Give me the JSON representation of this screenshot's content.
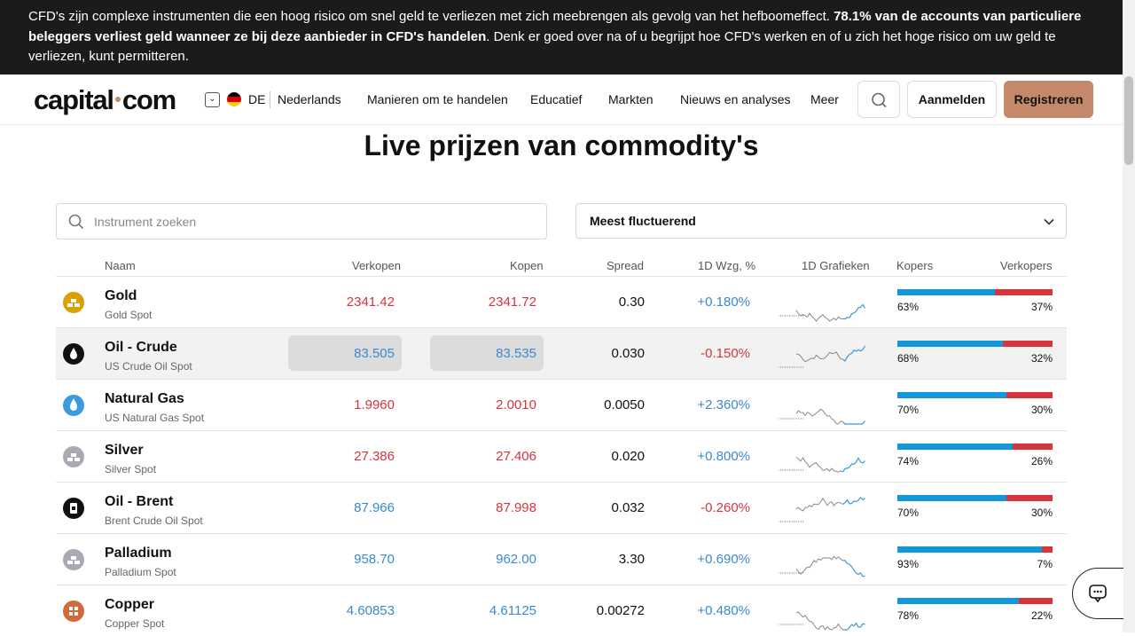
{
  "risk_banner": {
    "part1": "CFD's zijn complexe instrumenten die een hoog risico om snel geld te verliezen met zich meebrengen als gevolg van het hefboomeffect. ",
    "bold": "78.1% van de accounts van particuliere beleggers verliest geld wanneer ze bij deze aanbieder in CFD's handelen",
    "part2": ". Denk er goed over na of u begrijpt hoe CFD's werken en of u zich het hoge risico om uw geld te verliezen, kunt permitteren."
  },
  "header": {
    "logo": "capital·com",
    "logo_left": "capital",
    "logo_right": "com",
    "lang_code": "DE",
    "lang_name": "Nederlands",
    "nav": [
      "Manieren om te handelen",
      "Educatief",
      "Markten",
      "Nieuws en analyses",
      "Meer"
    ],
    "login": "Aanmelden",
    "register": "Registreren"
  },
  "page_title": "Live prijzen van commodity's",
  "search": {
    "placeholder": "Instrument zoeken"
  },
  "sort": {
    "selected": "Meest fluctuerend"
  },
  "columns": {
    "name": "Naam",
    "sell": "Verkopen",
    "buy": "Kopen",
    "spread": "Spread",
    "change": "1D Wzg, %",
    "charts": "1D Grafieken",
    "buyers": "Kopers",
    "sellers": "Verkopers"
  },
  "rows": [
    {
      "name": "Gold",
      "sub": "Gold Spot",
      "sell": "2341.42",
      "buy": "2341.72",
      "spread": "0.30",
      "change": "+0.180%",
      "buyers": "63%",
      "sellers": "37%",
      "buyers_frac": 0.63,
      "price_color": "red",
      "change_color": "blue",
      "icon": "gold-bars-icon",
      "icon_color": "#d8a100",
      "highlight": false
    },
    {
      "name": "Oil - Crude",
      "sub": "US Crude Oil Spot",
      "sell": "83.505",
      "buy": "83.535",
      "spread": "0.030",
      "change": "-0.150%",
      "buyers": "68%",
      "sellers": "32%",
      "buyers_frac": 0.68,
      "price_color": "blue",
      "change_color": "red",
      "icon": "oil-drop-icon",
      "icon_color": "#111111",
      "highlight": true
    },
    {
      "name": "Natural Gas",
      "sub": "US Natural Gas Spot",
      "sell": "1.9960",
      "buy": "2.0010",
      "spread": "0.0050",
      "change": "+2.360%",
      "buyers": "70%",
      "sellers": "30%",
      "buyers_frac": 0.7,
      "price_color": "red",
      "change_color": "blue",
      "icon": "flame-icon",
      "icon_color": "#3b9be0",
      "highlight": false
    },
    {
      "name": "Silver",
      "sub": "Silver Spot",
      "sell": "27.386",
      "buy": "27.406",
      "spread": "0.020",
      "change": "+0.800%",
      "buyers": "74%",
      "sellers": "26%",
      "buyers_frac": 0.74,
      "price_color": "red",
      "change_color": "blue",
      "icon": "silver-bars-icon",
      "icon_color": "#a9a9b3",
      "highlight": false
    },
    {
      "name": "Oil - Brent",
      "sub": "Brent Crude Oil Spot",
      "sell": "87.966",
      "buy": "87.998",
      "spread": "0.032",
      "change": "-0.260%",
      "buyers": "70%",
      "sellers": "30%",
      "buyers_frac": 0.7,
      "price_color": "blue",
      "price_color_buy": "red",
      "change_color": "red",
      "icon": "oil-barrel-icon",
      "icon_color": "#111111",
      "highlight": false
    },
    {
      "name": "Palladium",
      "sub": "Palladium Spot",
      "sell": "958.70",
      "buy": "962.00",
      "spread": "3.30",
      "change": "+0.690%",
      "buyers": "93%",
      "sellers": "7%",
      "buyers_frac": 0.93,
      "price_color": "blue",
      "change_color": "blue",
      "icon": "palladium-bars-icon",
      "icon_color": "#a9a9b3",
      "highlight": false
    },
    {
      "name": "Copper",
      "sub": "Copper Spot",
      "sell": "4.60853",
      "buy": "4.61125",
      "spread": "0.00272",
      "change": "+0.480%",
      "buyers": "78%",
      "sellers": "22%",
      "buyers_frac": 0.78,
      "price_color": "blue",
      "change_color": "blue",
      "icon": "copper-icon",
      "icon_color": "#d06a3a",
      "highlight": false
    }
  ],
  "colors": {
    "accent": "#c4886a",
    "buyers_bar": "#1497d8",
    "sellers_bar": "#d6343e",
    "negative": "#d6343e",
    "positive": "#3a89d0"
  }
}
